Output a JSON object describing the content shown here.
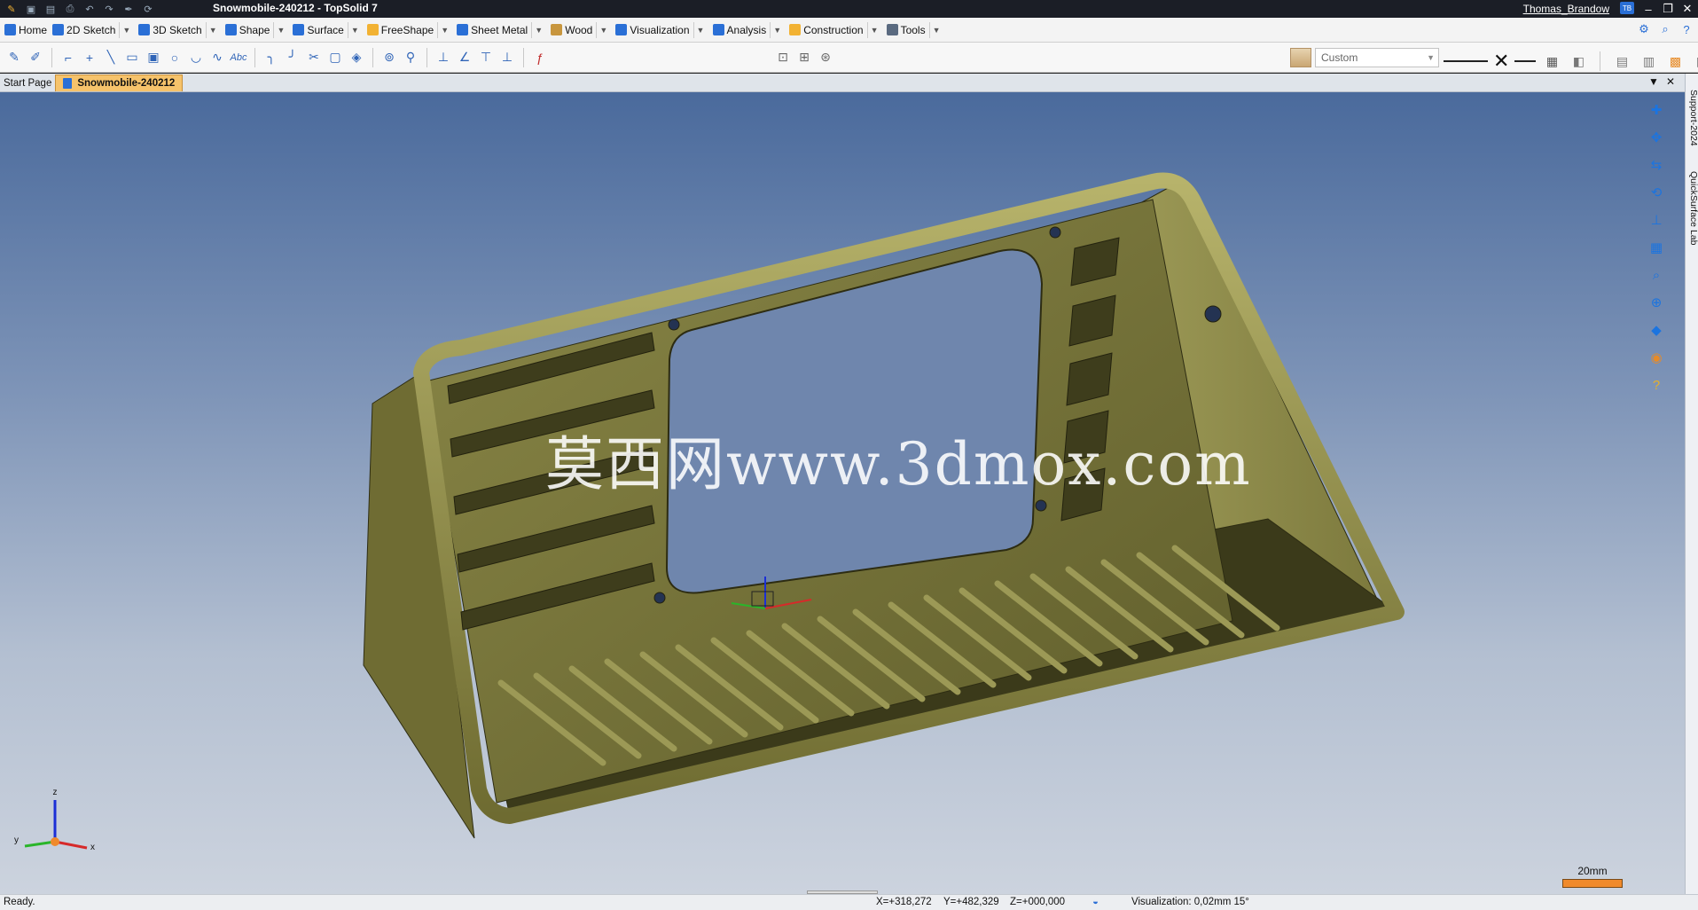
{
  "window": {
    "title": "Snowmobile-240212 - TopSolid 7",
    "user": "Thomas_Brandow",
    "user_badge": "TB"
  },
  "ribbon_tabs": [
    {
      "label": "Home",
      "icon": "home-icon",
      "color": "#2a6fd6"
    },
    {
      "label": "2D Sketch",
      "icon": "pencil-icon",
      "color": "#2a6fd6"
    },
    {
      "label": "3D Sketch",
      "icon": "pencil-3d-icon",
      "color": "#2a6fd6"
    },
    {
      "label": "Shape",
      "icon": "cube-icon",
      "color": "#2a6fd6"
    },
    {
      "label": "Surface",
      "icon": "surface-icon",
      "color": "#2a6fd6"
    },
    {
      "label": "FreeShape",
      "icon": "freeshape-icon",
      "color": "#f2b233"
    },
    {
      "label": "Sheet Metal",
      "icon": "sheet-metal-icon",
      "color": "#2a6fd6"
    },
    {
      "label": "Wood",
      "icon": "wood-icon",
      "color": "#c8963e"
    },
    {
      "label": "Visualization",
      "icon": "visualization-icon",
      "color": "#2a6fd6"
    },
    {
      "label": "Analysis",
      "icon": "analysis-icon",
      "color": "#2a6fd6"
    },
    {
      "label": "Construction",
      "icon": "construction-icon",
      "color": "#f2b233"
    },
    {
      "label": "Tools",
      "icon": "tools-icon",
      "color": "#5a6a80"
    }
  ],
  "toolbar": {
    "style_preset": "Custom"
  },
  "doc_tabs": {
    "start_page": "Start Page",
    "active": "Snowmobile-240212"
  },
  "viewport": {
    "watermark": "莫西网www.3dmox.com",
    "scale_label": "20mm",
    "axes": {
      "x": "x",
      "y": "y",
      "z": "z"
    }
  },
  "sidebar": {
    "panel_a": "Support-2024",
    "panel_b": "QuickSurface Lab"
  },
  "status": {
    "message": "Ready.",
    "x": "X=+318,272",
    "y": "Y=+482,329",
    "z": "Z=+000,000",
    "visualization": "Visualization: 0,02mm 15°"
  },
  "colors": {
    "part": "#7d7a3c",
    "active_doc_tab": "#f6c36b"
  }
}
